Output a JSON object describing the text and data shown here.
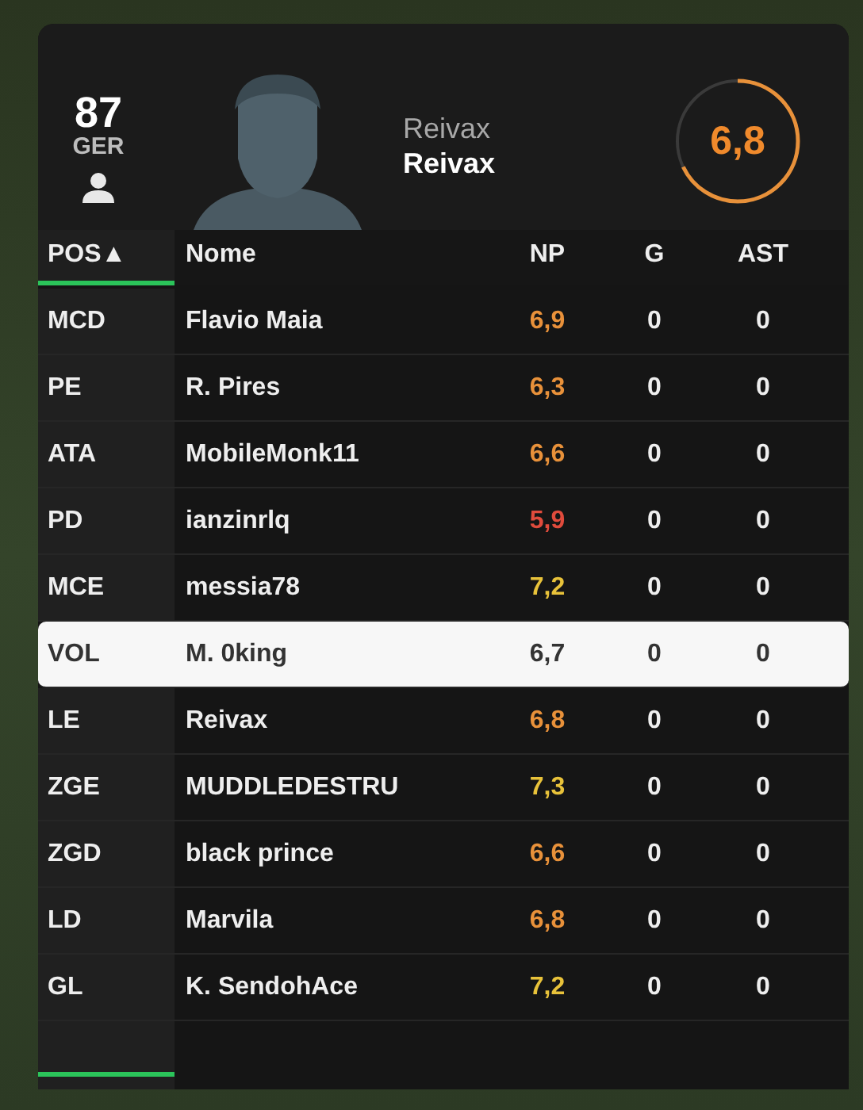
{
  "player_card": {
    "overall": "87",
    "nation": "GER",
    "name_top": "Reivax",
    "name_bottom": "Reivax",
    "rating": "6,8"
  },
  "table": {
    "columns": [
      {
        "label": "POS▲",
        "selected": true
      },
      {
        "label": "Nome",
        "selected": false
      },
      {
        "label": "NP",
        "selected": false
      },
      {
        "label": "G",
        "selected": false
      },
      {
        "label": "AST",
        "selected": false
      }
    ],
    "rows": [
      {
        "pos": "MCD",
        "name": "Flavio Maia",
        "np": "6,9",
        "color": "#e8913a",
        "g": "0",
        "ast": "0",
        "selected": false
      },
      {
        "pos": "PE",
        "name": "R. Pires",
        "np": "6,3",
        "color": "#e8913a",
        "g": "0",
        "ast": "0",
        "selected": false
      },
      {
        "pos": "ATA",
        "name": "MobileMonk11",
        "np": "6,6",
        "color": "#e8913a",
        "g": "0",
        "ast": "0",
        "selected": false
      },
      {
        "pos": "PD",
        "name": "ianzinrlq",
        "np": "5,9",
        "color": "#e04b3c",
        "g": "0",
        "ast": "0",
        "selected": false
      },
      {
        "pos": "MCE",
        "name": "messia78",
        "np": "7,2",
        "color": "#e8c23a",
        "g": "0",
        "ast": "0",
        "selected": false
      },
      {
        "pos": "VOL",
        "name": "M. 0king",
        "np": "6,7",
        "color": "#333333",
        "g": "0",
        "ast": "0",
        "selected": true
      },
      {
        "pos": "LE",
        "name": "Reivax",
        "np": "6,8",
        "color": "#e8913a",
        "g": "0",
        "ast": "0",
        "selected": false
      },
      {
        "pos": "ZGE",
        "name": "MUDDLEDESTRU",
        "np": "7,3",
        "color": "#e8c23a",
        "g": "0",
        "ast": "0",
        "selected": false
      },
      {
        "pos": "ZGD",
        "name": "black prince",
        "np": "6,6",
        "color": "#e8913a",
        "g": "0",
        "ast": "0",
        "selected": false
      },
      {
        "pos": "LD",
        "name": "Marvila",
        "np": "6,8",
        "color": "#e8913a",
        "g": "0",
        "ast": "0",
        "selected": false
      },
      {
        "pos": "GL",
        "name": "K. SendohAce",
        "np": "7,2",
        "color": "#e8c23a",
        "g": "0",
        "ast": "0",
        "selected": false
      }
    ]
  }
}
